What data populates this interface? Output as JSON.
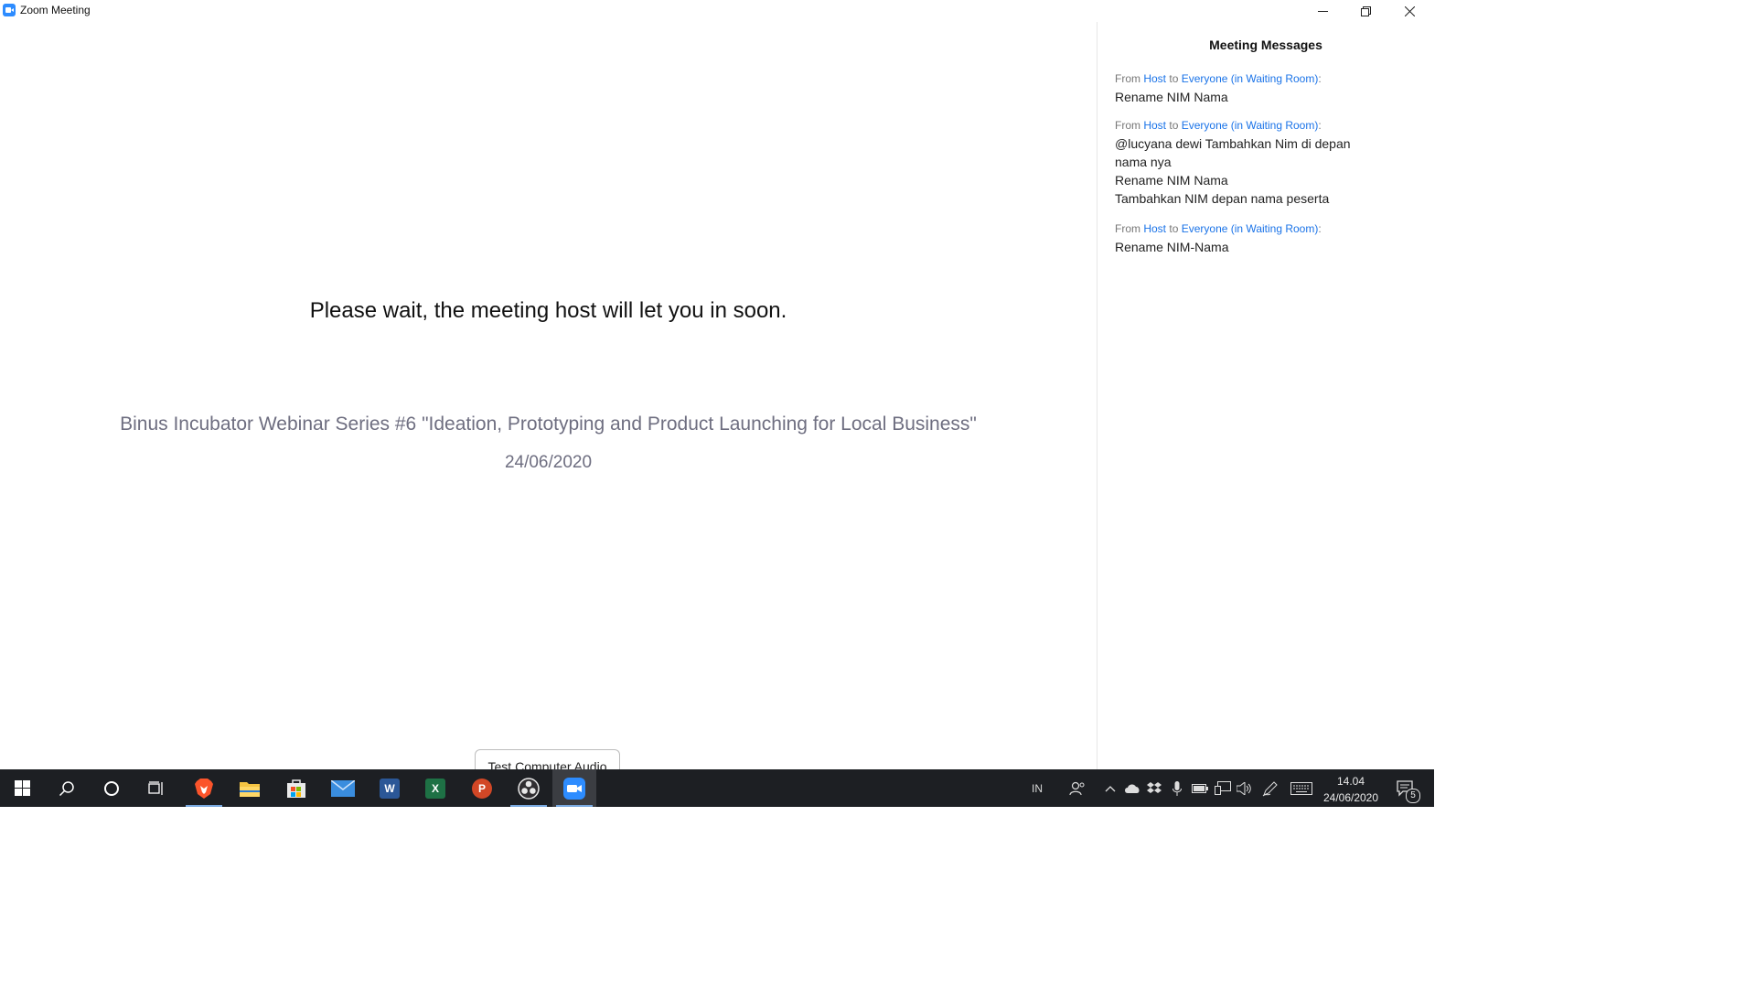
{
  "window": {
    "title": "Zoom Meeting",
    "icon": "zoom-icon",
    "controls": [
      "minimize-icon",
      "restore-icon",
      "close-icon"
    ]
  },
  "waiting_room": {
    "message": "Please wait, the meeting host will let you in soon.",
    "topic": "Binus Incubator Webinar Series #6 \"Ideation, Prototyping and Product Launching for Local Business\"",
    "date": "24/06/2020",
    "test_audio_button": "Test Computer Audio"
  },
  "messages_panel": {
    "title": "Meeting Messages",
    "messages": [
      {
        "from_label": "From",
        "sender": "Host",
        "to_label": "to",
        "recipient": "Everyone (in Waiting Room)",
        "colon": ":",
        "lines": [
          "Rename NIM Nama"
        ]
      },
      {
        "from_label": "From",
        "sender": "Host",
        "to_label": "to",
        "recipient": "Everyone (in Waiting Room)",
        "colon": ":",
        "lines": [
          "@lucyana dewi Tambahkan Nim di depan",
          "nama nya",
          "Rename NIM Nama",
          "Tambahkan NIM depan nama peserta"
        ]
      },
      {
        "from_label": "From",
        "sender": "Host",
        "to_label": "to",
        "recipient": "Everyone (in Waiting Room)",
        "colon": ":",
        "lines": [
          "Rename NIM-Nama"
        ]
      }
    ],
    "link_color": "#1a73e8"
  },
  "taskbar": {
    "apps": [
      {
        "name": "start-button",
        "icon": "windows-icon"
      },
      {
        "name": "search-button",
        "icon": "search-icon"
      },
      {
        "name": "cortana-button",
        "icon": "cortana-icon"
      },
      {
        "name": "task-view-button",
        "icon": "task-view-icon"
      },
      {
        "name": "brave-app",
        "icon": "brave-icon"
      },
      {
        "name": "file-explorer-app",
        "icon": "folder-icon"
      },
      {
        "name": "store-app",
        "icon": "store-icon"
      },
      {
        "name": "mail-app",
        "icon": "mail-icon"
      },
      {
        "name": "word-app",
        "icon": "word-icon",
        "letter": "W"
      },
      {
        "name": "excel-app",
        "icon": "excel-icon",
        "letter": "X"
      },
      {
        "name": "powerpoint-app",
        "icon": "powerpoint-icon",
        "letter": "P"
      },
      {
        "name": "obs-app",
        "icon": "obs-icon"
      },
      {
        "name": "zoom-app",
        "icon": "zoom-icon",
        "active": true
      }
    ],
    "tray": {
      "language": "IN",
      "clock_time": "14.04",
      "clock_date": "24/06/2020",
      "notification_count": "5"
    }
  }
}
